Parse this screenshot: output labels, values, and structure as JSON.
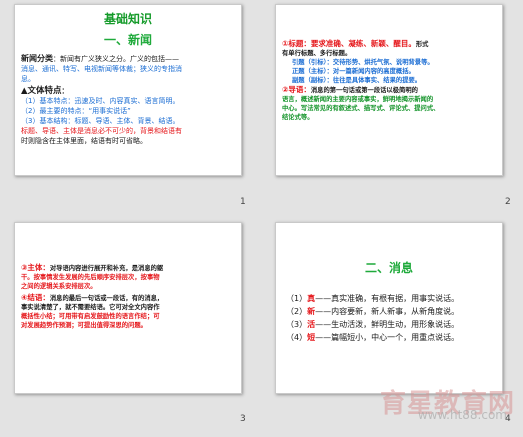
{
  "slides": [
    {
      "number": "1",
      "title": "基础知识",
      "subtitle": "一、新闻",
      "def_label": "新闻分类",
      "def_line1": "：新闻有广义狭义之分。广义的包括——",
      "def_line2": "消息、通讯、特写、电视新闻等体裁；狭义的专指消",
      "def_line3": "息。",
      "features_label": "▲文体特点",
      "features_colon": "：",
      "f1": "（1）基本特点：迅速及时、内容真实、语言简明。",
      "f2": "（2）最主要的特点：“用事实说话”",
      "f3": "（3）基本结构：标题、导语、主体、背景、结语。",
      "f4": "标题、导语、主体是消息必不可少的，背景和结语有",
      "f5": "时则隐含在主体里面，结语有时可省略。"
    },
    {
      "number": "2",
      "p1_a": "①标题：要求准确、凝练、新颖、醒目。",
      "p1_b": "形式",
      "p1_c": "有单行标题、多行标题。",
      "p2": "引题（引标）：交待形势、烘托气氛、说明背景等。",
      "p3": "正题（主标）：对一篇新闻内容的高度概括。",
      "p4": "副题（副标）：往往是具体事实、结果的提要。",
      "p5_a": "②导语：",
      "p5_b": "消息的第一句话或第一段话以极简明的",
      "p6": "语言，概述新闻的主要内容或事实，鲜明地揭示新闻的",
      "p7": "中心。写法常见的有叙述式、描写式、评论式、提问式、",
      "p8": "结论式等。"
    },
    {
      "number": "3",
      "q1_a": "③主体：",
      "q1_b": "对导语内容进行展开和补充，是消息的躯",
      "q2": "干。按事情发生发展的先后顺序安排层次，按事物",
      "q3": "之间的逻辑关系安排层次。",
      "q4_a": "④结语：",
      "q4_b": "消息的最后一句话或一段话，有的消息，",
      "q5": "事实说清楚了，就不需要结语。它可对全文内容作",
      "q6": "概括性小结；可用带有启发鼓励性的语言作结；可",
      "q7": "对发展趋势作预测；可提出值得深思的问题。"
    },
    {
      "number": "4",
      "title": "二、消息",
      "items": [
        {
          "prefix": "（1）",
          "key": "真",
          "text": "——真实准确，有根有据，用事实说话。"
        },
        {
          "prefix": "（2）",
          "key": "新",
          "text": "——内容要新，新人新事，从新角度说。"
        },
        {
          "prefix": "（3）",
          "key": "活",
          "text": "——生动活泼，鲜明生动，用形象说话。"
        },
        {
          "prefix": "（4）",
          "key": "短",
          "text": "——篇幅短小，中心一个，用重点说话。"
        }
      ]
    }
  ],
  "watermark": {
    "text": "育星教育网",
    "url": "www.ht88.com"
  },
  "colors": {
    "green": "#159b2a",
    "blue": "#1b6dd3",
    "red": "#e5161a"
  }
}
